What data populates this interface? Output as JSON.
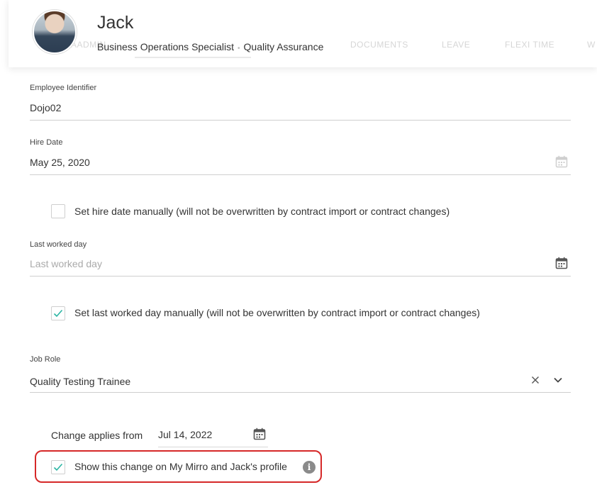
{
  "header": {
    "name": "Jack",
    "job_title": "Business Operations Specialist",
    "separator": "•",
    "department": "Quality Assurance",
    "tabs_ghost": [
      "AADMIN",
      "DOCUMENTS",
      "LEAVE",
      "FLEXI TIME",
      "W"
    ]
  },
  "form": {
    "employee_identifier": {
      "label": "Employee Identifier",
      "value": "Dojo02"
    },
    "hire_date": {
      "label": "Hire Date",
      "value": "May 25, 2020"
    },
    "hire_manual": {
      "checked": false,
      "label": "Set hire date manually (will not be overwritten by contract import or contract changes)"
    },
    "last_worked_day": {
      "label": "Last worked day",
      "placeholder": "Last worked day"
    },
    "last_worked_manual": {
      "checked": true,
      "label": "Set last worked day manually (will not be overwritten by contract import or contract changes)"
    },
    "job_role": {
      "label": "Job Role",
      "value": "Quality Testing Trainee"
    },
    "change_applies": {
      "label": "Change applies from",
      "value": "Jul 14, 2022"
    },
    "show_change": {
      "checked": true,
      "label": "Show this change on My Mirro and Jack's profile"
    }
  },
  "colors": {
    "check_accent": "#2bb5a3",
    "highlight": "#d62828",
    "info_icon": "#8a8a8a"
  },
  "icons": [
    "calendar-icon",
    "clear-icon",
    "chevron-down-icon",
    "info-icon",
    "checkmark-icon"
  ]
}
